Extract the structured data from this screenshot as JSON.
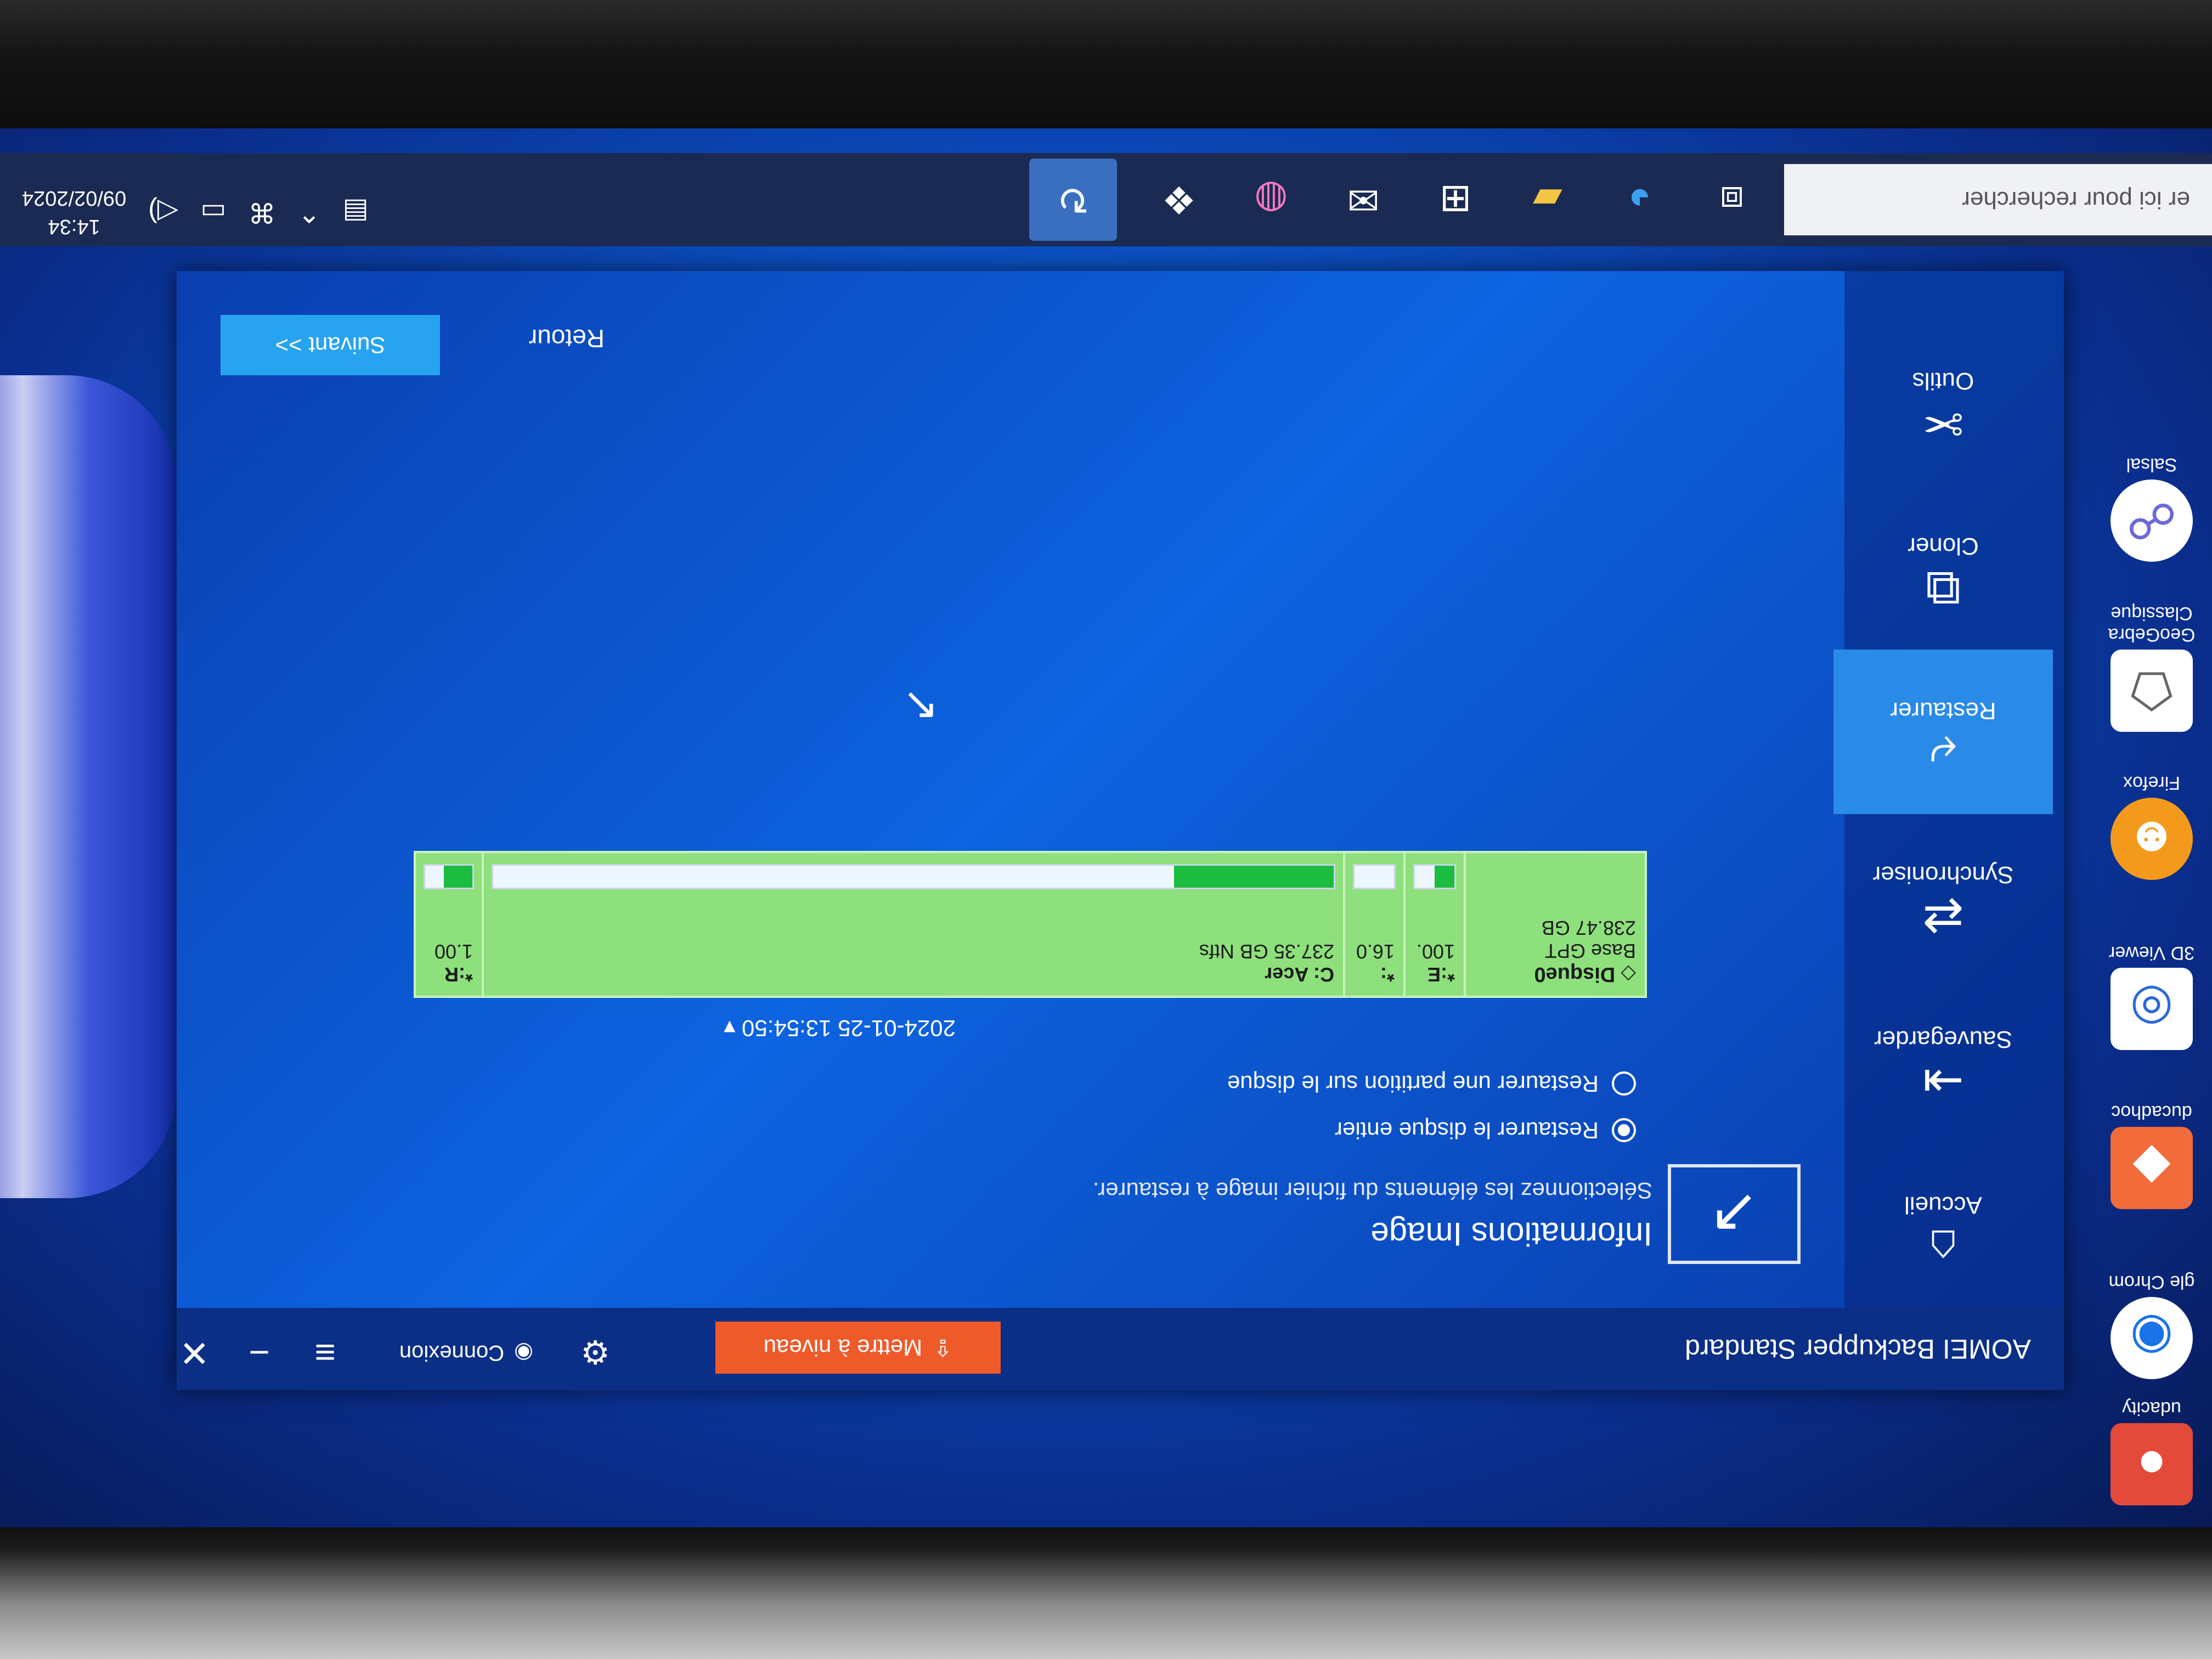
{
  "app": {
    "title": "AOMEI Backupper Standard",
    "upgrade_label": "Mettre à niveau",
    "login_label": "Connexion"
  },
  "sidebar": {
    "items": [
      {
        "label": "Accueil"
      },
      {
        "label": "Sauvegarder"
      },
      {
        "label": "Synchroniser"
      },
      {
        "label": "Restaurer"
      },
      {
        "label": "Cloner"
      },
      {
        "label": "Outils"
      }
    ],
    "active": "Restaurer"
  },
  "content": {
    "title": "Informations Image",
    "subtitle": "Sélectionnez les éléments du fichier image à restaurer.",
    "radio_whole_disk": "Restaurer le disque entier",
    "radio_partition": "Restaurer une partition sur le disque",
    "backup_date": "2024-01-25 13:54:50",
    "disk": {
      "name": "Disque0",
      "type": "Base GPT",
      "size": "238.47 GB",
      "partitions": [
        {
          "label": "*:E",
          "size": "100.",
          "fill": 0.5
        },
        {
          "label": "*:",
          "size": "16.0",
          "fill": 0.0
        },
        {
          "label": "C: Acer",
          "size": "237.35 GB Ntfs",
          "fill": 0.19
        },
        {
          "label": "*:R",
          "size": "1.00",
          "fill": 0.6
        }
      ]
    },
    "back_label": "Retour",
    "next_label": "Suivant >>"
  },
  "taskbar": {
    "search_placeholder": "er ici pour rechercher",
    "time": "14:34",
    "date": "09/02/2024"
  },
  "desktop": {
    "items": [
      {
        "label": "udacity"
      },
      {
        "label": "gle Chrom"
      },
      {
        "label": "ducadhoc"
      },
      {
        "label": "3D Viewer"
      },
      {
        "label": "Firefox"
      },
      {
        "label": "GeoGebra Classique"
      },
      {
        "label": "Salsal"
      }
    ]
  },
  "colors": {
    "upgrade": "#ef5a2a",
    "accent": "#2a8ae8",
    "next": "#27a3f0",
    "disk_map": "#8ee07c"
  }
}
